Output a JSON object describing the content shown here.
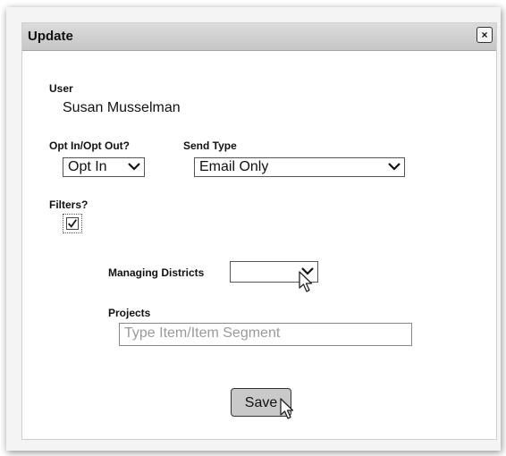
{
  "dialog": {
    "title": "Update",
    "close_label": "×"
  },
  "user": {
    "label": "User",
    "name": "Susan Musselman"
  },
  "opt": {
    "label": "Opt In/Opt Out?",
    "selected": "Opt In"
  },
  "send_type": {
    "label": "Send Type",
    "selected": "Email Only"
  },
  "filters": {
    "label": "Filters?",
    "checked": true
  },
  "managing_districts": {
    "label": "Managing Districts",
    "selected": ""
  },
  "projects": {
    "label": "Projects",
    "placeholder": "Type Item/Item Segment"
  },
  "save_label": "Save",
  "icons": [
    "close-icon",
    "chevron-down-icon",
    "checkmark-icon",
    "mouse-cursor-icon"
  ]
}
